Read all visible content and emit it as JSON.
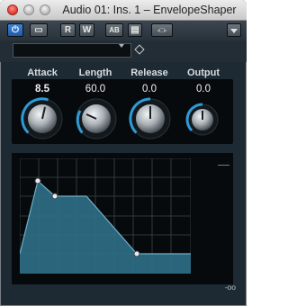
{
  "window": {
    "title": "Audio 01: Ins. 1 – EnvelopeShaper"
  },
  "toolbar": {
    "buttons": [
      {
        "name": "power",
        "label": "⏻"
      },
      {
        "name": "bypass",
        "label": "▭"
      },
      {
        "name": "read",
        "label": "R"
      },
      {
        "name": "write",
        "label": "W"
      },
      {
        "name": "ab",
        "label": "AB"
      },
      {
        "name": "settings",
        "label": "▤"
      },
      {
        "name": "sidechain",
        "label": "-□-"
      }
    ]
  },
  "preset": {
    "value": ""
  },
  "params": [
    {
      "label": "Attack",
      "value": "8.5"
    },
    {
      "label": "Length",
      "value": "60.0"
    },
    {
      "label": "Release",
      "value": "0.0"
    },
    {
      "label": "Output",
      "value": "0.0"
    }
  ],
  "meter": {
    "bottom_label": "-oo"
  },
  "colors": {
    "accent": "#2e9bd6",
    "envelope_fill": "#2f6f87",
    "envelope_stroke": "#6fb0c8"
  }
}
